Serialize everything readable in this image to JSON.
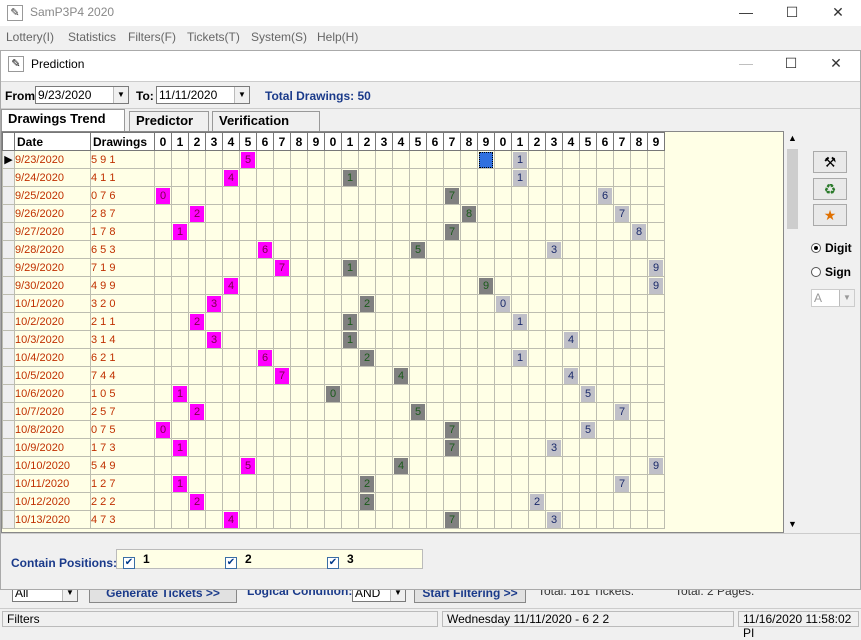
{
  "app": {
    "title": "SamP3P4 2020",
    "minimize": "—",
    "maximize": "☐",
    "close": "✕",
    "menu": [
      "Lottery(I)",
      "Statistics",
      "Filters(F)",
      "Tickets(T)",
      "System(S)",
      "Help(H)"
    ]
  },
  "dialog": {
    "title": "Prediction",
    "maximize": "☐",
    "close": "✕",
    "from_label": "From:",
    "from_value": "9/23/2020",
    "to_label": "To:",
    "to_value": "11/11/2020",
    "total_drawings": "Total Drawings: 50",
    "tabs": [
      "Drawings Trend",
      "Predictor",
      "Verification"
    ],
    "active_tab": 0,
    "columns": [
      "Date",
      "Drawings"
    ],
    "digits": [
      "0",
      "1",
      "2",
      "3",
      "4",
      "5",
      "6",
      "7",
      "8",
      "9",
      "0",
      "1",
      "2",
      "3",
      "4",
      "5",
      "6",
      "7",
      "8",
      "9",
      "0",
      "1",
      "2",
      "3",
      "4",
      "5",
      "6",
      "7",
      "8",
      "9"
    ],
    "rows": [
      {
        "date": "9/23/2020",
        "draw": "5 9 1",
        "d": [
          5,
          9,
          1
        ],
        "sel": true
      },
      {
        "date": "9/24/2020",
        "draw": "4 1 1",
        "d": [
          4,
          1,
          1
        ]
      },
      {
        "date": "9/25/2020",
        "draw": "0 7 6",
        "d": [
          0,
          7,
          6
        ]
      },
      {
        "date": "9/26/2020",
        "draw": "2 8 7",
        "d": [
          2,
          8,
          7
        ]
      },
      {
        "date": "9/27/2020",
        "draw": "1 7 8",
        "d": [
          1,
          7,
          8
        ]
      },
      {
        "date": "9/28/2020",
        "draw": "6 5 3",
        "d": [
          6,
          5,
          3
        ]
      },
      {
        "date": "9/29/2020",
        "draw": "7 1 9",
        "d": [
          7,
          1,
          9
        ]
      },
      {
        "date": "9/30/2020",
        "draw": "4 9 9",
        "d": [
          4,
          9,
          9
        ]
      },
      {
        "date": "10/1/2020",
        "draw": "3 2 0",
        "d": [
          3,
          2,
          0
        ]
      },
      {
        "date": "10/2/2020",
        "draw": "2 1 1",
        "d": [
          2,
          1,
          1
        ]
      },
      {
        "date": "10/3/2020",
        "draw": "3 1 4",
        "d": [
          3,
          1,
          4
        ]
      },
      {
        "date": "10/4/2020",
        "draw": "6 2 1",
        "d": [
          6,
          2,
          1
        ]
      },
      {
        "date": "10/5/2020",
        "draw": "7 4 4",
        "d": [
          7,
          4,
          4
        ]
      },
      {
        "date": "10/6/2020",
        "draw": "1 0 5",
        "d": [
          1,
          0,
          5
        ]
      },
      {
        "date": "10/7/2020",
        "draw": "2 5 7",
        "d": [
          2,
          5,
          7
        ]
      },
      {
        "date": "10/8/2020",
        "draw": "0 7 5",
        "d": [
          0,
          7,
          5
        ]
      },
      {
        "date": "10/9/2020",
        "draw": "1 7 3",
        "d": [
          1,
          7,
          3
        ]
      },
      {
        "date": "10/10/2020",
        "draw": "5 4 9",
        "d": [
          5,
          4,
          9
        ]
      },
      {
        "date": "10/11/2020",
        "draw": "1 2 7",
        "d": [
          1,
          2,
          7
        ]
      },
      {
        "date": "10/12/2020",
        "draw": "2 2 2",
        "d": [
          2,
          2,
          2
        ]
      },
      {
        "date": "10/13/2020",
        "draw": "4 7 3",
        "d": [
          4,
          7,
          3
        ]
      }
    ],
    "side_tools": [
      "hammer-icon",
      "recycle-icon",
      "star-icon"
    ],
    "radio_digit": "Digit",
    "radio_sign": "Sign",
    "sign_combo": "A",
    "contain_label": "Contain Positions:",
    "positions": [
      "1",
      "2",
      "3"
    ],
    "colors": {
      "pos1": "#ff00ff",
      "pos2": "#808080",
      "pos3": "#c0c0c8",
      "grid_bg": "#ffffe6",
      "date_text": "#c03000"
    }
  },
  "under": {
    "all_combo": "All",
    "generate_btn": "Generate Tickets >>",
    "logical_label": "Logical Condition:",
    "logical_value": "AND",
    "start_btn": "Start Filtering >>",
    "total_tickets": "Total: 161 Tickets.",
    "total_pages": "Total: 2 Pages."
  },
  "status": {
    "left": "Filters",
    "middle": "Wednesday 11/11/2020 - 6 2 2",
    "right": "11/16/2020 11:58:02 PI"
  }
}
